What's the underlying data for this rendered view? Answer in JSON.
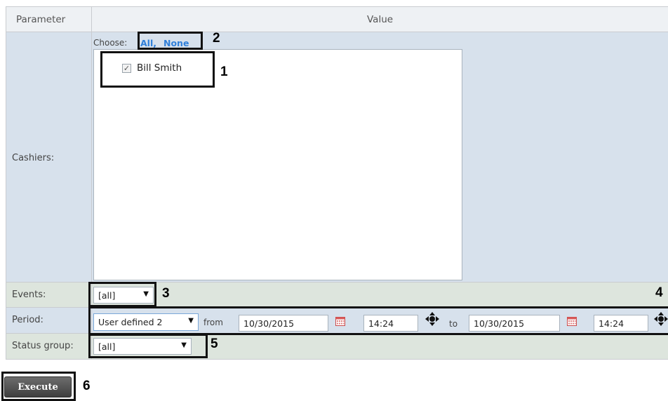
{
  "table": {
    "header": {
      "parameter": "Parameter",
      "value": "Value"
    },
    "rows": {
      "cashiers": {
        "label": "Cashiers:",
        "choose_label": "Choose:",
        "all": "All,",
        "none": "None",
        "items": [
          {
            "label": "Bill Smith",
            "checked": true
          }
        ]
      },
      "events": {
        "label": "Events:",
        "value": "[all]"
      },
      "period": {
        "label": "Period:",
        "preset": "User defined 2",
        "from_label": "from",
        "from_date": "10/30/2015",
        "from_time": "14:24",
        "to_label": "to",
        "to_date": "10/30/2015",
        "to_time": "14:24"
      },
      "status_group": {
        "label": "Status group:",
        "value": "[all]"
      }
    }
  },
  "execute_label": "Execute",
  "annotations": {
    "n1": "1",
    "n2": "2",
    "n3": "3",
    "n4": "4",
    "n5": "5",
    "n6": "6"
  },
  "icons": {
    "checkbox": "check-mark",
    "calendar": "calendar-icon",
    "arrows": "move-arrows-icon",
    "dropdown": "triangle-down"
  },
  "colors": {
    "header_bg": "#eef1f4",
    "blue_row": "#d7e1ec",
    "green_row": "#dde5dd",
    "link": "#2f7fd9",
    "button": "#4a4a4a"
  }
}
